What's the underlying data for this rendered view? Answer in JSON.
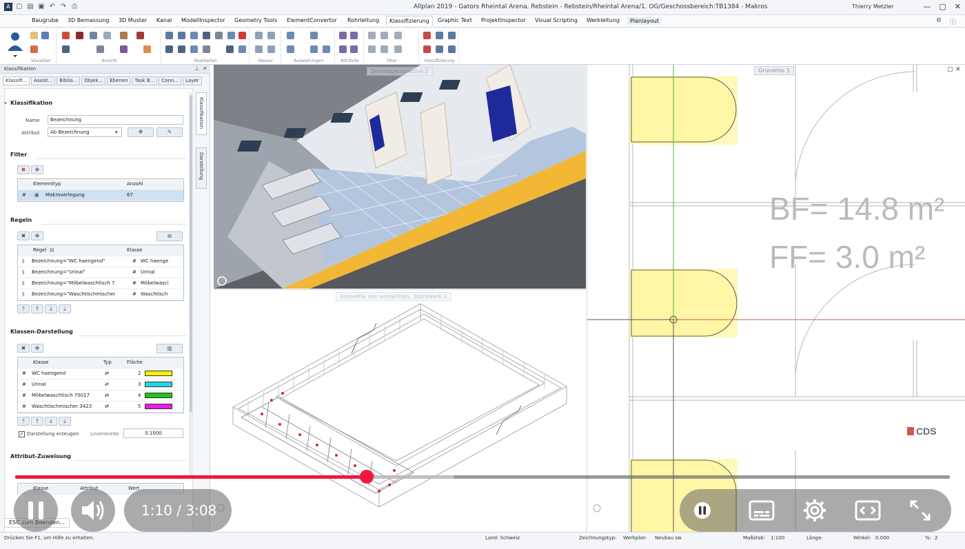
{
  "app": {
    "title": "Allplan 2019 - Gators Rheintal Arena, Rebstein - Rebstein/Rheintal Arena/1. OG/Geschossbereich:TB1384 - Makros",
    "user": "Thierry Metzler"
  },
  "ribbon_tabs": [
    "Baugrube",
    "3D Bemassung",
    "3D Muster",
    "Kanal",
    "ModellInspector",
    "Geometry Tools",
    "ElementConvertor",
    "Rohrleitung",
    "Klassifizierung",
    "Graphic Text",
    "ProjektInspector",
    "Visual Scripting",
    "Werkleitung",
    "Planlayout"
  ],
  "ribbon_active_tab": "Klassifizierung",
  "ribbon_groups": [
    "Visualizer",
    "Ansicht",
    "Bearbeiten",
    "Wasser",
    "Auswertungen",
    "Attribute",
    "Filter",
    "Klassifizierung"
  ],
  "panel": {
    "title": "Klassifikation",
    "tabs": [
      "Klassifi...",
      "Assist...",
      "Biblio...",
      "Objek...",
      "Ebenen",
      "Task B...",
      "Conn...",
      "Layer"
    ],
    "vertical_tabs": [
      "Klassifikation",
      "Darstellung"
    ],
    "klassifikation": {
      "heading": "Klassifikation",
      "name_label": "Name",
      "name_value": "Bezeichnung",
      "attribut_label": "Attribut",
      "attribut_value": "Ab  Bezeichnung"
    },
    "filter": {
      "heading": "Filter",
      "columns": [
        "Elementtyp",
        "Anzahl"
      ],
      "rows": [
        {
          "type": "Makroverlegung",
          "count": "67"
        }
      ]
    },
    "regeln": {
      "heading": "Regeln",
      "columns": [
        "Regel",
        "Klasse"
      ],
      "rows": [
        {
          "regel": "Bezeichnung=\"WC haengend\"",
          "klasse": "WC haenge"
        },
        {
          "regel": "Bezeichnung=\"Urinal\"",
          "klasse": "Urinal"
        },
        {
          "regel": "Bezeichnung=\"Möbelwaschtisch 7",
          "klasse": "Möbelwasci"
        },
        {
          "regel": "Bezeichnung=\"Waschtischmischer",
          "klasse": "Waschtisch"
        }
      ]
    },
    "darstellung": {
      "heading": "Klassen-Darstellung",
      "columns": [
        "Klasse",
        "Typ",
        "Fläche"
      ],
      "rows": [
        {
          "klasse": "WC haengend",
          "flaeche": "2",
          "color": "#f4f000"
        },
        {
          "klasse": "Urinal",
          "flaeche": "3",
          "color": "#22d6e8"
        },
        {
          "klasse": "Möbelwaschtisch 70017",
          "flaeche": "4",
          "color": "#1fc414"
        },
        {
          "klasse": "Waschtischmischer 3423",
          "flaeche": "5",
          "color": "#e81ee0"
        }
      ],
      "checkbox_label": "Darstellung erzeugen",
      "linienbreite_label": "Linienbreite",
      "linienbreite_value": "0.1000"
    },
    "zuweisung": {
      "heading": "Attribut-Zuweisung",
      "columns": [
        "Klasse",
        "Attribut",
        "Wert"
      ]
    }
  },
  "viewports": {
    "perspective_label": "Zentralperspektive 2",
    "isometric_label": "Isometrie von vorne/links, Stockwerk 2",
    "plan_label": "Grundriss 1",
    "plan_text_bf": "BF= 14.8 m²",
    "plan_text_ff": "FF= 3.0 m²",
    "watermark": "CDS"
  },
  "video": {
    "time": "1:10 / 3:08",
    "progress": 0.376,
    "buffered": 0.47
  },
  "status": {
    "esc": "ESC zum Beenden...",
    "help": "Drücken Sie F1, um Hilfe zu erhalten.",
    "land": "Land: Schweiz",
    "zeichnungstyp_label": "Zeichnungstyp:",
    "zeichnungstyp_value": "Werkplan",
    "neubau": "Neubau sw",
    "massstab_label": "Maßstab:",
    "massstab_value": "1:100",
    "laenge_label": "Länge:",
    "winkel_label": "Winkel:",
    "winkel_value": "0.000",
    "pct": "%:",
    "pct_value": "2"
  }
}
